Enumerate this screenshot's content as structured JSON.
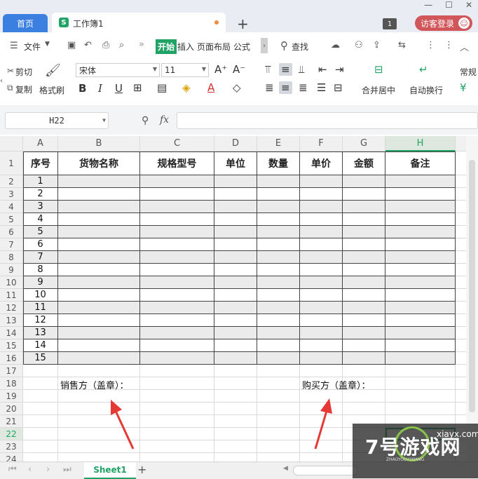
{
  "tabs": {
    "home_label": "首页",
    "doc_title": "工作簿1",
    "doc_icon_letter": "S",
    "new_tab_symbol": "+",
    "badge_count": "1",
    "visitor_label": "访客登录"
  },
  "menu": {
    "items": [
      "文件",
      "开始",
      "插入",
      "页面布局",
      "公式",
      "查找"
    ],
    "overflow_symbol": "»"
  },
  "ribbon": {
    "cut_label": "剪切",
    "copy_label": "复制",
    "format_painter_label": "格式刷",
    "font_name": "宋体",
    "font_size": "11",
    "merge_label": "合并居中",
    "wrap_label": "自动换行",
    "number_format": "常规",
    "bold": "B",
    "italic": "I",
    "underline": "U"
  },
  "formula_bar": {
    "name_box": "H22",
    "fx_label": "fx",
    "formula": ""
  },
  "sheet": {
    "columns": [
      "A",
      "B",
      "C",
      "D",
      "E",
      "F",
      "G",
      "H"
    ],
    "selected_column": "H",
    "rows": [
      "1",
      "2",
      "3",
      "4",
      "5",
      "6",
      "7",
      "8",
      "9",
      "10",
      "11",
      "12",
      "13",
      "14",
      "15",
      "16",
      "17",
      "18",
      "19",
      "20",
      "21",
      "22",
      "23",
      "24"
    ],
    "selected_row": "22",
    "headers": [
      "序号",
      "货物名称",
      "规格型号",
      "单位",
      "数量",
      "单价",
      "金额",
      "备注"
    ],
    "serials": [
      "1",
      "2",
      "3",
      "4",
      "5",
      "6",
      "7",
      "8",
      "9",
      "10",
      "11",
      "12",
      "13",
      "14",
      "15"
    ],
    "seller_label": "销售方（盖章）：",
    "buyer_label": "购买方（盖章）："
  },
  "bottom": {
    "sheet_name": "Sheet1",
    "add_sheet_symbol": "+"
  },
  "watermark": {
    "brand": "7号游戏网",
    "domain": "xiayx.com",
    "sub": "ZHAOYOUXIWANG"
  },
  "colors": {
    "accent_green": "#21a366",
    "tab_blue": "#3b7fe0",
    "visitor_red": "#d0565a",
    "arrow_red": "#e53935"
  }
}
